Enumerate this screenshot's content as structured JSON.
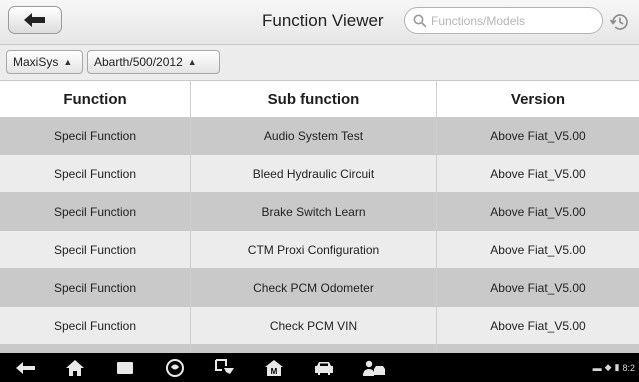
{
  "header": {
    "title": "Function Viewer",
    "search": {
      "placeholder": "Functions/Models",
      "value": ""
    }
  },
  "filters": [
    {
      "label": "MaxiSys"
    },
    {
      "label": "Abarth/500/2012"
    }
  ],
  "table": {
    "columns": [
      "Function",
      "Sub function",
      "Version"
    ],
    "rows": [
      {
        "function": "Specil Function",
        "sub_function": "Audio System Test",
        "version": "Above Fiat_V5.00"
      },
      {
        "function": "Specil Function",
        "sub_function": "Bleed Hydraulic Circuit",
        "version": "Above Fiat_V5.00"
      },
      {
        "function": "Specil Function",
        "sub_function": "Brake Switch Learn",
        "version": "Above Fiat_V5.00"
      },
      {
        "function": "Specil Function",
        "sub_function": "CTM Proxi Configuration",
        "version": "Above Fiat_V5.00"
      },
      {
        "function": "Specil Function",
        "sub_function": "Check PCM Odometer",
        "version": "Above Fiat_V5.00"
      },
      {
        "function": "Specil Function",
        "sub_function": "Check PCM VIN",
        "version": "Above Fiat_V5.00"
      }
    ]
  },
  "navbar": {
    "icons": [
      "back-arrow-icon",
      "home-icon",
      "recent-apps-icon",
      "browser-icon",
      "screen-capture-icon",
      "maxisys-home-icon",
      "vehicle-icon",
      "vehicle-service-icon"
    ],
    "status_time": "8:2"
  },
  "colors": {
    "row_shade": "#c9c9c9",
    "row_plain": "#ececec",
    "navbar": "#000000"
  }
}
